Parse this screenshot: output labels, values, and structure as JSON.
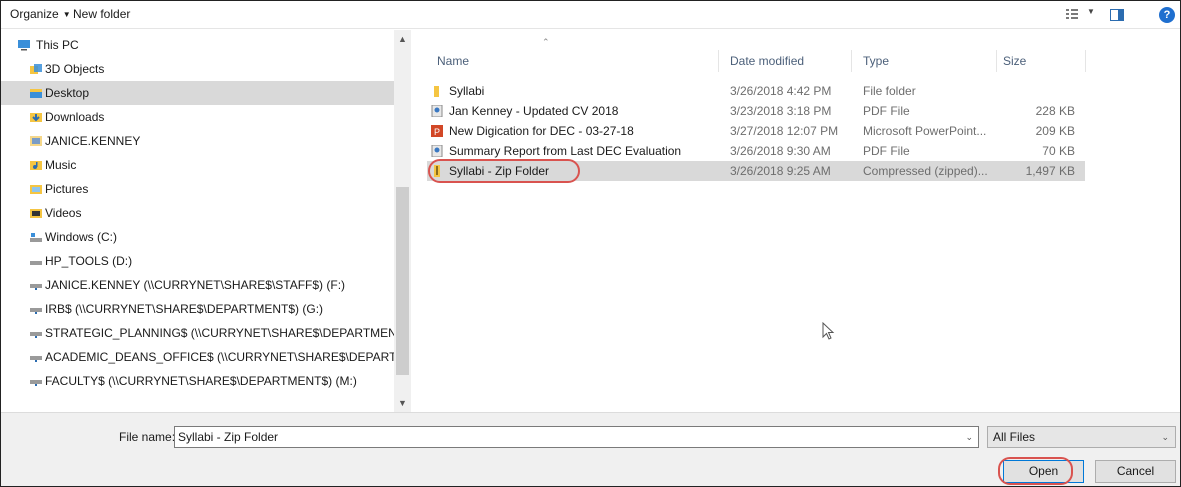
{
  "toolbar": {
    "organize_label": "Organize",
    "new_folder_label": "New folder"
  },
  "nav": {
    "items": [
      {
        "label": "This PC",
        "icon": "computer-icon"
      },
      {
        "label": "3D Objects",
        "icon": "3d-objects-icon"
      },
      {
        "label": "Desktop",
        "icon": "desktop-folder-icon",
        "selected": true
      },
      {
        "label": "Downloads",
        "icon": "downloads-icon"
      },
      {
        "label": "JANICE.KENNEY",
        "icon": "user-folder-icon"
      },
      {
        "label": "Music",
        "icon": "music-icon"
      },
      {
        "label": "Pictures",
        "icon": "pictures-icon"
      },
      {
        "label": "Videos",
        "icon": "videos-icon"
      },
      {
        "label": "Windows (C:)",
        "icon": "drive-icon"
      },
      {
        "label": "HP_TOOLS (D:)",
        "icon": "drive-icon"
      },
      {
        "label": "JANICE.KENNEY (\\\\CURRYNET\\SHARE$\\STAFF$) (F:)",
        "icon": "network-drive-icon"
      },
      {
        "label": "IRB$ (\\\\CURRYNET\\SHARE$\\DEPARTMENT$) (G:)",
        "icon": "network-drive-icon"
      },
      {
        "label": "STRATEGIC_PLANNING$ (\\\\CURRYNET\\SHARE$\\DEPARTMENT$) (I",
        "icon": "network-drive-icon"
      },
      {
        "label": "ACADEMIC_DEANS_OFFICE$ (\\\\CURRYNET\\SHARE$\\DEPARTMEN",
        "icon": "network-drive-icon"
      },
      {
        "label": "FACULTY$ (\\\\CURRYNET\\SHARE$\\DEPARTMENT$) (M:)",
        "icon": "network-drive-icon"
      }
    ]
  },
  "columns": {
    "name": "Name",
    "date": "Date modified",
    "type": "Type",
    "size": "Size"
  },
  "files": [
    {
      "name": "Syllabi",
      "date": "3/26/2018 4:42 PM",
      "type": "File folder",
      "size": "",
      "icon": "folder-icon"
    },
    {
      "name": "Jan Kenney - Updated CV 2018",
      "date": "3/23/2018 3:18 PM",
      "type": "PDF File",
      "size": "228 KB",
      "icon": "pdf-icon"
    },
    {
      "name": "New Digication for DEC - 03-27-18",
      "date": "3/27/2018 12:07 PM",
      "type": "Microsoft PowerPoint...",
      "size": "209 KB",
      "icon": "powerpoint-icon"
    },
    {
      "name": "Summary Report from Last DEC Evaluation",
      "date": "3/26/2018 9:30 AM",
      "type": "PDF File",
      "size": "70 KB",
      "icon": "pdf-icon"
    },
    {
      "name": "Syllabi - Zip Folder",
      "date": "3/26/2018 9:25 AM",
      "type": "Compressed (zipped)...",
      "size": "1,497 KB",
      "icon": "zip-folder-icon",
      "selected": true
    }
  ],
  "footer": {
    "file_name_label": "File name:",
    "file_name_value": "Syllabi - Zip Folder",
    "filter_value": "All Files",
    "open_label": "Open",
    "cancel_label": "Cancel"
  },
  "colors": {
    "selection": "#d9d9d9",
    "highlight_circle": "#d9534f",
    "folder_yellow": "#f5c542",
    "accent_blue": "#0078d7"
  }
}
